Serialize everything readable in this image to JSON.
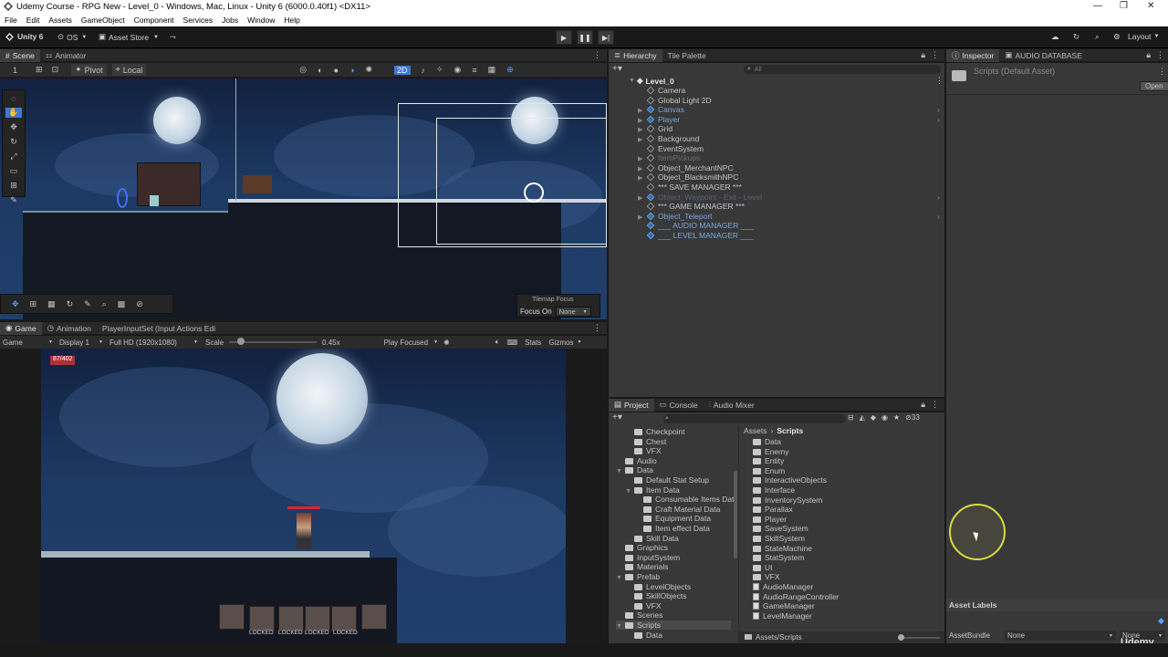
{
  "window": {
    "title": "Udemy Course - RPG New - Level_0 - Windows, Mac, Linux - Unity 6 (6000.0.40f1) <DX11>"
  },
  "menu": [
    "File",
    "Edit",
    "Assets",
    "GameObject",
    "Component",
    "Services",
    "Jobs",
    "Window",
    "Help"
  ],
  "toolbar": {
    "unity": "Unity 6",
    "os": "OS",
    "asset_store": "Asset Store",
    "layout": "Layout"
  },
  "scene": {
    "tabs": [
      "Scene",
      "Animator"
    ],
    "pivot": "Pivot",
    "local": "Local",
    "mode_2d": "2D",
    "layer_index": "1",
    "tilemap_focus": "Tilemap Focus",
    "focus_on_label": "Focus On",
    "focus_on_value": "None"
  },
  "game": {
    "tabs": [
      "Game",
      "Animation",
      "PlayerInputSet (Input Actions Edi"
    ],
    "mode": "Game",
    "display": "Display 1",
    "resolution": "Full HD (1920x1080)",
    "scale_label": "Scale",
    "scale_value": "0.45x",
    "scale_fraction": 0.1,
    "play_focused": "Play Focused",
    "stats": "Stats",
    "gizmos": "Gizmos",
    "hp": "87/402",
    "slot_labels": [
      "LOCKED",
      "LOCKED",
      "LOCKED",
      "LOCKED"
    ]
  },
  "hierarchy": {
    "tabs": [
      "Hierarchy",
      "Tile Palette"
    ],
    "search_placeholder": "All",
    "root": "Level_0",
    "items": [
      {
        "name": "Camera",
        "color": "#c4c4c4",
        "icon": "gameobject-icon",
        "expand": false
      },
      {
        "name": "Global Light 2D",
        "color": "#c4c4c4",
        "icon": "gameobject-icon",
        "expand": false
      },
      {
        "name": "Canvas",
        "color": "#7aa6e0",
        "icon": "prefab-icon",
        "expand": true
      },
      {
        "name": "Player",
        "color": "#7aa6e0",
        "icon": "prefab-icon",
        "expand": true
      },
      {
        "name": "Grid",
        "color": "#c4c4c4",
        "icon": "gameobject-icon",
        "expand": true
      },
      {
        "name": "Background",
        "color": "#c4c4c4",
        "icon": "gameobject-icon",
        "expand": true
      },
      {
        "name": "EventSystem",
        "color": "#c4c4c4",
        "icon": "gameobject-icon",
        "expand": false
      },
      {
        "name": "ItemPickups",
        "color": "#6b6b6b",
        "icon": "gameobject-icon",
        "expand": true
      },
      {
        "name": "Object_MerchantNPC",
        "color": "#c4c4c4",
        "icon": "gameobject-icon",
        "expand": true
      },
      {
        "name": "Object_BlacksmithNPC",
        "color": "#c4c4c4",
        "icon": "gameobject-icon",
        "expand": true
      },
      {
        "name": "*** SAVE MANAGER ***",
        "color": "#c4c4c4",
        "icon": "gameobject-icon",
        "expand": false
      },
      {
        "name": "Object_Waypoint - Exit - Level",
        "color": "#55607a",
        "icon": "prefab-icon",
        "expand": true
      },
      {
        "name": "*** GAME MANAGER ***",
        "color": "#c4c4c4",
        "icon": "gameobject-icon",
        "expand": false
      },
      {
        "name": "Object_Teleport",
        "color": "#7aa6e0",
        "icon": "prefab-icon",
        "expand": true
      },
      {
        "name": "___ AUDIO MANAGER ___",
        "color": "#7aa6e0",
        "icon": "prefab-icon",
        "expand": false
      },
      {
        "name": "___ LEVEL MANAGER ___",
        "color": "#7aa6e0",
        "icon": "prefab-icon",
        "expand": false
      }
    ]
  },
  "inspector": {
    "tabs": [
      "Inspector",
      "AUDIO DATABASE"
    ],
    "asset_title": "Scripts (Default Asset)",
    "open_button": "Open",
    "asset_labels": "Asset Labels",
    "asset_bundle_label": "AssetBundle",
    "asset_bundle_value": "None",
    "asset_bundle_variant": "None"
  },
  "project": {
    "tabs": [
      "Project",
      "Console",
      "Audio Mixer"
    ],
    "count": "33",
    "breadcrumb": [
      "Assets",
      "Scripts"
    ],
    "tree": [
      {
        "name": "Checkpoint",
        "indent": 2,
        "expand": false
      },
      {
        "name": "Chest",
        "indent": 2,
        "expand": false
      },
      {
        "name": "VFX",
        "indent": 2,
        "expand": false
      },
      {
        "name": "Audio",
        "indent": 1,
        "expand": false
      },
      {
        "name": "Data",
        "indent": 1,
        "expand": true
      },
      {
        "name": "Default Stat Setup",
        "indent": 2,
        "expand": false
      },
      {
        "name": "Item Data",
        "indent": 2,
        "expand": true
      },
      {
        "name": "Consumable Items Dat",
        "indent": 3,
        "expand": false
      },
      {
        "name": "Craft Material Data",
        "indent": 3,
        "expand": false
      },
      {
        "name": "Equipment Data",
        "indent": 3,
        "expand": false
      },
      {
        "name": "Item effect Data",
        "indent": 3,
        "expand": false
      },
      {
        "name": "Skill Data",
        "indent": 2,
        "expand": false
      },
      {
        "name": "Graphics",
        "indent": 1,
        "expand": false
      },
      {
        "name": "InputSystem",
        "indent": 1,
        "expand": false
      },
      {
        "name": "Materials",
        "indent": 1,
        "expand": false
      },
      {
        "name": "Prefab",
        "indent": 1,
        "expand": true
      },
      {
        "name": "LevelObjects",
        "indent": 2,
        "expand": false
      },
      {
        "name": "SkillObjects",
        "indent": 2,
        "expand": false
      },
      {
        "name": "VFX",
        "indent": 2,
        "expand": false
      },
      {
        "name": "Scenes",
        "indent": 1,
        "expand": false
      },
      {
        "name": "Scripts",
        "indent": 1,
        "expand": true,
        "selected": true
      },
      {
        "name": "Data",
        "indent": 2,
        "expand": false
      }
    ],
    "folders": [
      "Data",
      "Enemy",
      "Entity",
      "Enum",
      "InteractiveObjects",
      "Interface",
      "InventorySystem",
      "Parallax",
      "Player",
      "SaveSystem",
      "SkillSystem",
      "StateMachine",
      "StatSystem",
      "UI",
      "VFX"
    ],
    "scripts": [
      "AudioManager",
      "AudioRangeController",
      "GameManager",
      "LevelManager"
    ],
    "footer_path": "Assets/Scripts"
  },
  "watermark": "Udemy",
  "colors": {
    "accent": "#3a79d8",
    "prefab_blue": "#7aa6e0",
    "panel": "#383838",
    "dark": "#191919"
  }
}
